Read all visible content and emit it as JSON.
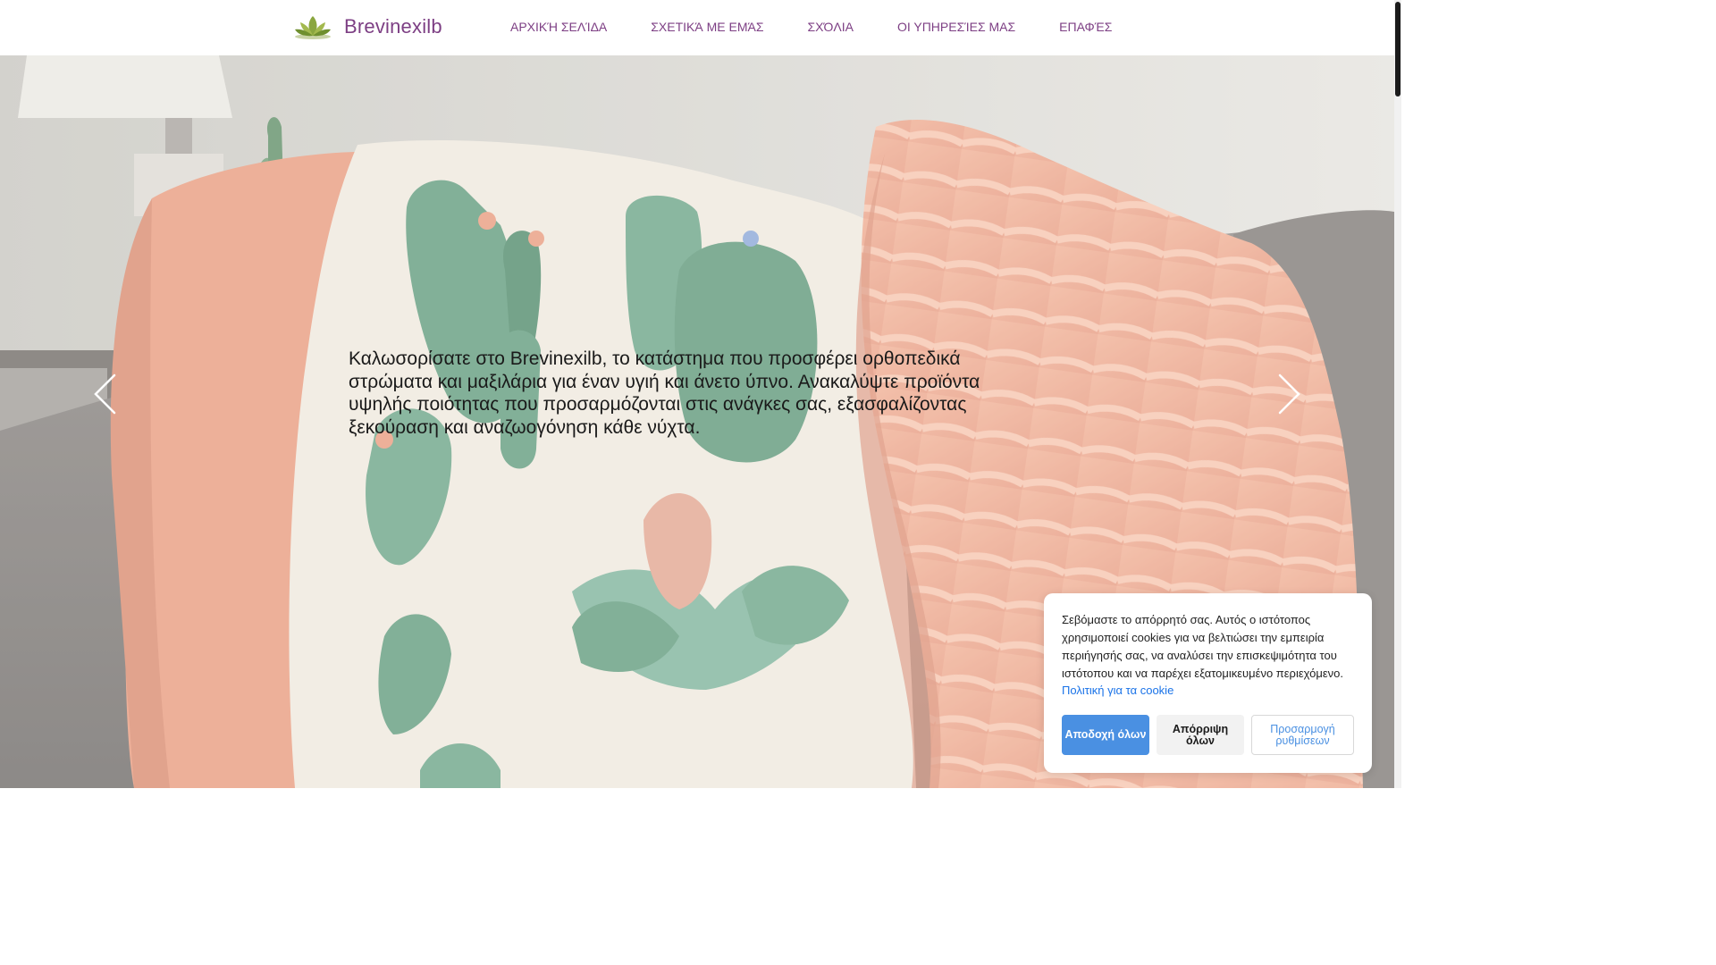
{
  "header": {
    "brand": "Brevinexilb",
    "nav": [
      "ΑΡΧΙΚΉ ΣΕΛΊΔΑ",
      "ΣΧΕΤΙΚΆ ΜΕ ΕΜΆΣ",
      "ΣΧΌΛΙΑ",
      "ΟΙ ΥΠΗΡΕΣΊΕΣ ΜΑΣ",
      "ΕΠΑΦΈΣ"
    ]
  },
  "hero": {
    "text": "Καλωσορίσατε στο Brevinexilb, το κατάστημα που προσφέρει ορθοπεδικά στρώματα και μαξιλάρια για έναν υγιή και άνετο ύπνο. Ανακαλύψτε προϊόντα υψηλής ποιότητας που προσαρμόζονται στις ανάγκες σας, εξασφαλίζοντας ξεκούραση και αναζωογόνηση κάθε νύχτα."
  },
  "cookie": {
    "text": "Σεβόμαστε το απόρρητό σας. Αυτός ο ιστότοπος χρησιμοποιεί cookies για να βελτιώσει την εμπειρία περιήγησής σας, να αναλύσει την επισκεψιμότητα του ιστότοπου και να παρέχει εξατομικευμένο περιεχόμενο.",
    "policy_link": "Πολιτική για τα cookie",
    "accept": "Αποδοχή όλων",
    "reject": "Απόρριψη όλων",
    "customize": "Προσαρμογή ρυθμίσεων"
  },
  "colors": {
    "brand": "#7d3f84",
    "accent": "#4a90e2"
  },
  "icons": [
    "lotus-logo-icon",
    "chevron-left-icon",
    "chevron-right-icon"
  ]
}
